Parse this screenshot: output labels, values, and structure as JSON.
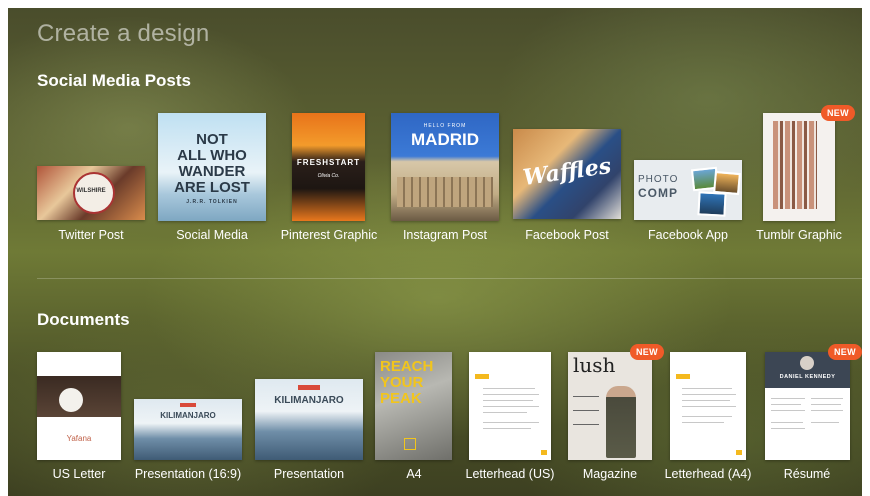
{
  "page": {
    "title": "Create a design"
  },
  "sections": {
    "social": {
      "title": "Social Media Posts",
      "items": [
        {
          "label": "Twitter Post",
          "thumb_text": [
            "WILSHIRE"
          ]
        },
        {
          "label": "Social Media",
          "thumb_text": [
            "NOT",
            "ALL WHO",
            "WANDER",
            "ARE LOST",
            "J.R.R. TOLKIEN"
          ]
        },
        {
          "label": "Pinterest Graphic",
          "thumb_text": [
            "FRESHSTART",
            "Olivia Co."
          ]
        },
        {
          "label": "Instagram Post",
          "thumb_text": [
            "HELLO FROM",
            "MADRID"
          ]
        },
        {
          "label": "Facebook Post",
          "thumb_text": [
            "Waffles"
          ]
        },
        {
          "label": "Facebook App",
          "thumb_text": [
            "PHOTO",
            "COMP"
          ]
        },
        {
          "label": "Tumblr Graphic",
          "thumb_text": [],
          "badge": "NEW"
        }
      ]
    },
    "documents": {
      "title": "Documents",
      "items": [
        {
          "label": "US Letter",
          "thumb_text": [
            "Yafana"
          ]
        },
        {
          "label": "Presentation (16:9)",
          "thumb_text": [
            "KILIMANJARO"
          ]
        },
        {
          "label": "Presentation",
          "thumb_text": [
            "KILIMANJARO"
          ]
        },
        {
          "label": "A4",
          "thumb_text": [
            "REACH",
            "YOUR",
            "PEAK"
          ]
        },
        {
          "label": "Letterhead (US)",
          "thumb_text": []
        },
        {
          "label": "Magazine",
          "thumb_text": [
            "lush"
          ],
          "badge": "NEW"
        },
        {
          "label": "Letterhead (A4)",
          "thumb_text": []
        },
        {
          "label": "Résumé",
          "thumb_text": [
            "DANIEL KENNEDY"
          ],
          "badge": "NEW"
        }
      ]
    }
  }
}
